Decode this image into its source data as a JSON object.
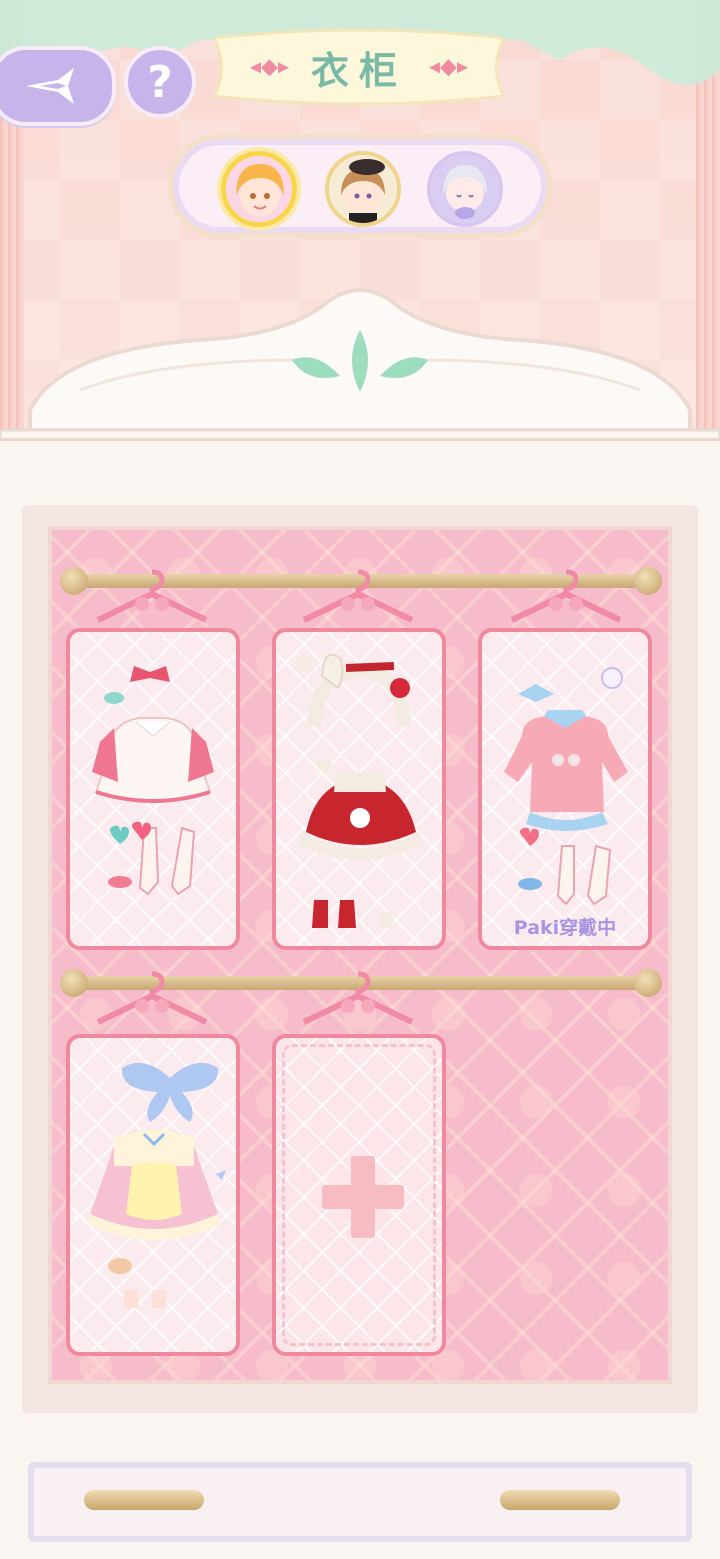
{
  "header": {
    "title": "衣柜",
    "back_icon": "sparkle-arrow-back-icon",
    "help_label": "?"
  },
  "characters": [
    {
      "name": "blonde-girl-avatar",
      "selected": true
    },
    {
      "name": "brown-hair-beret-avatar",
      "selected": false
    },
    {
      "name": "silver-hair-avatar",
      "selected": false
    }
  ],
  "wardrobe": {
    "rows": [
      {
        "outfits": [
          {
            "id": "outfit-pink-white-dress",
            "wearing_label": ""
          },
          {
            "id": "outfit-red-bunny-dress",
            "wearing_label": ""
          },
          {
            "id": "outfit-pink-sweater",
            "wearing_label": "Paki穿戴中"
          }
        ]
      },
      {
        "outfits": [
          {
            "id": "outfit-maid-dress",
            "wearing_label": ""
          }
        ],
        "add_slot": "plus-icon"
      }
    ]
  },
  "colors": {
    "accent_pink": "#f0889e",
    "wearing_purple": "#a795e3",
    "title_green": "#7ab9a6",
    "button_purple": "#c7b4ea"
  }
}
